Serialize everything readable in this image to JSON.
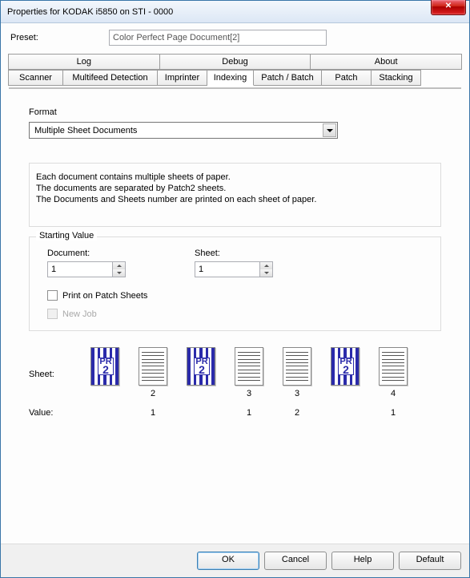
{
  "window": {
    "title": "Properties for KODAK i5850 on STI - 0000"
  },
  "preset": {
    "label": "Preset:",
    "value": "Color Perfect Page Document[2]"
  },
  "tabs_row1": [
    "Log",
    "Debug",
    "About"
  ],
  "tabs_row2": [
    "Scanner",
    "Multifeed Detection",
    "Imprinter",
    "Indexing",
    "Patch / Batch",
    "Patch",
    "Stacking"
  ],
  "format": {
    "label": "Format",
    "value": "Multiple Sheet Documents"
  },
  "description": {
    "l1": "Each document contains multiple sheets of paper.",
    "l2": "The documents are separated by Patch2  sheets.",
    "l3": "The Documents and Sheets number are printed on each sheet of paper."
  },
  "starting": {
    "title": "Starting Value",
    "doc_label": "Document:",
    "doc_value": "1",
    "sheet_label": "Sheet:",
    "sheet_value": "1",
    "print_patch": "Print on Patch Sheets",
    "new_job": "New Job"
  },
  "sheet_label": "Sheet:",
  "value_label": "Value:",
  "sheets": [
    {
      "type": "patch",
      "num": "",
      "val": ""
    },
    {
      "type": "doc",
      "num": "2",
      "val": "1"
    },
    {
      "type": "patch",
      "num": "",
      "val": ""
    },
    {
      "type": "doc",
      "num": "3",
      "val": "1"
    },
    {
      "type": "doc",
      "num": "3",
      "val": "2"
    },
    {
      "type": "patch",
      "num": "",
      "val": ""
    },
    {
      "type": "doc",
      "num": "4",
      "val": "1"
    }
  ],
  "buttons": {
    "ok": "OK",
    "cancel": "Cancel",
    "help": "Help",
    "default": "Default"
  },
  "patch_badge": {
    "top": "PR",
    "num": "2"
  }
}
